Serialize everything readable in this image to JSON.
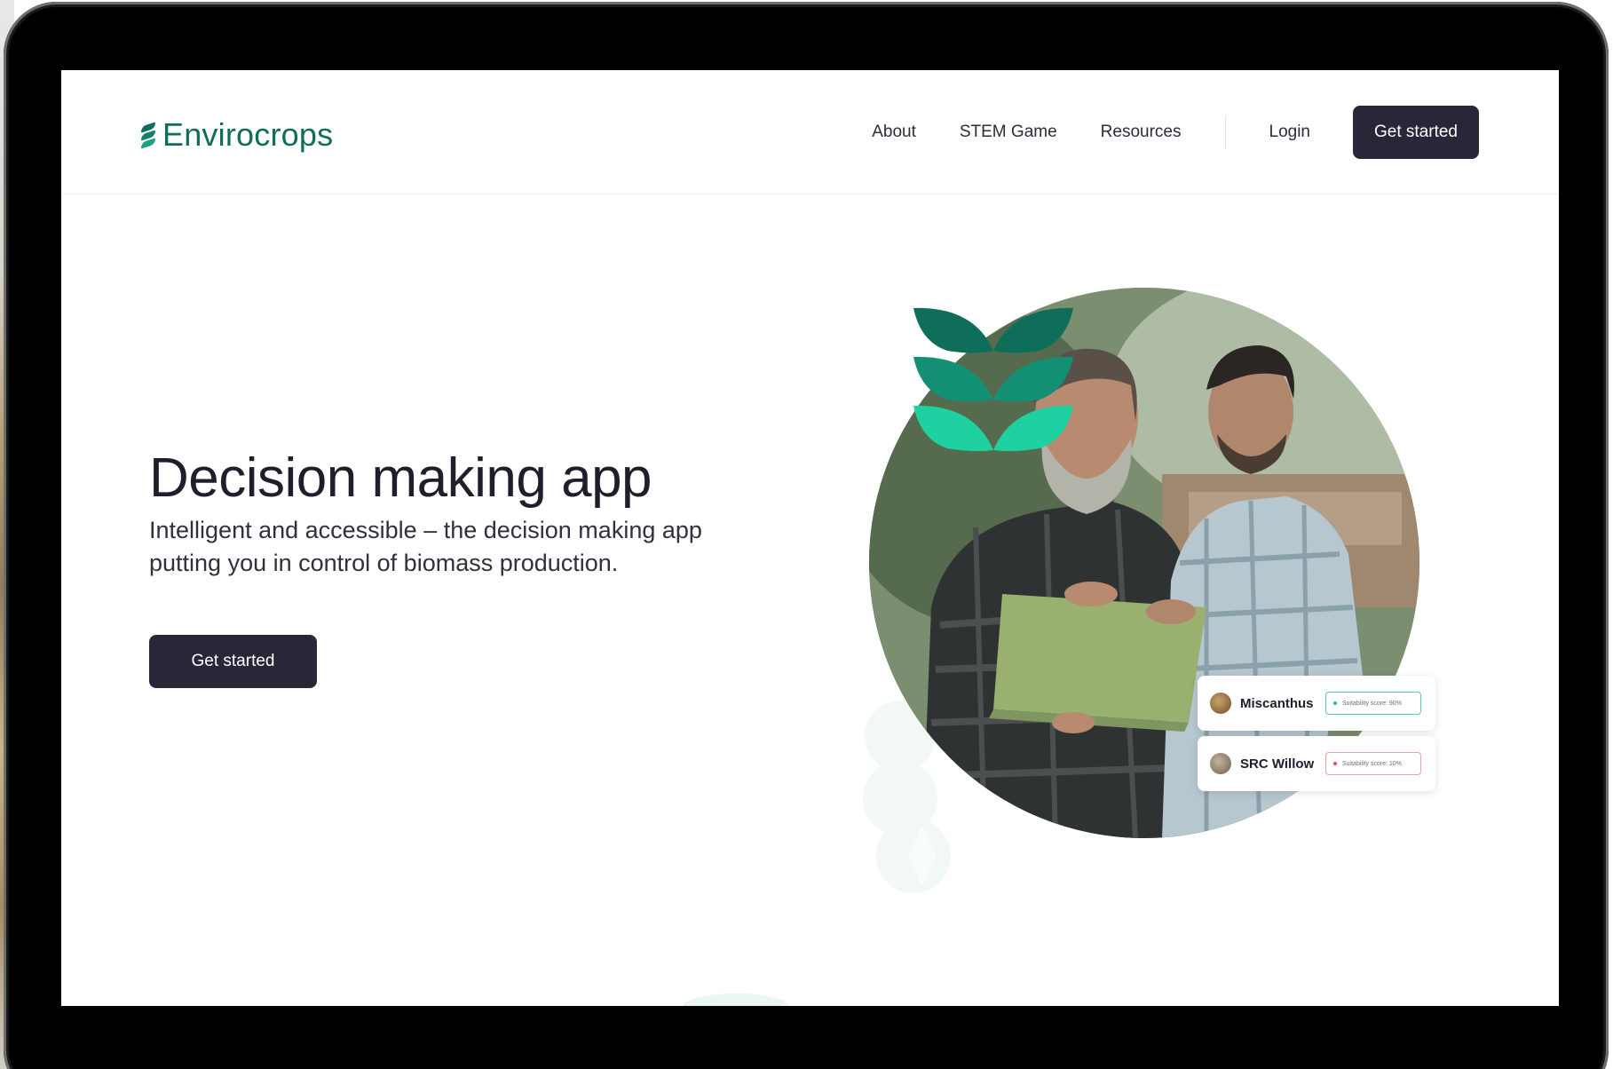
{
  "brand": {
    "name": "Envirocrops",
    "color": "#0f6e5a"
  },
  "nav": {
    "links": [
      "About",
      "STEM Game",
      "Resources"
    ],
    "login": "Login",
    "cta": "Get started"
  },
  "hero": {
    "title": "Decision making app",
    "subtitle": "Intelligent and accessible – the decision making app putting you in control of biomass production.",
    "cta": "Get started"
  },
  "cards": [
    {
      "name": "Miscanthus",
      "score": "Suitability score: 90%",
      "status": "good",
      "avatar": "#8a6a3c"
    },
    {
      "name": "SRC Willow",
      "score": "Suitability score: 10%",
      "status": "bad",
      "avatar": "#9a8a78"
    }
  ],
  "colors": {
    "button": "#272738",
    "accent_good": "#2bb592",
    "accent_bad": "#e05757"
  }
}
